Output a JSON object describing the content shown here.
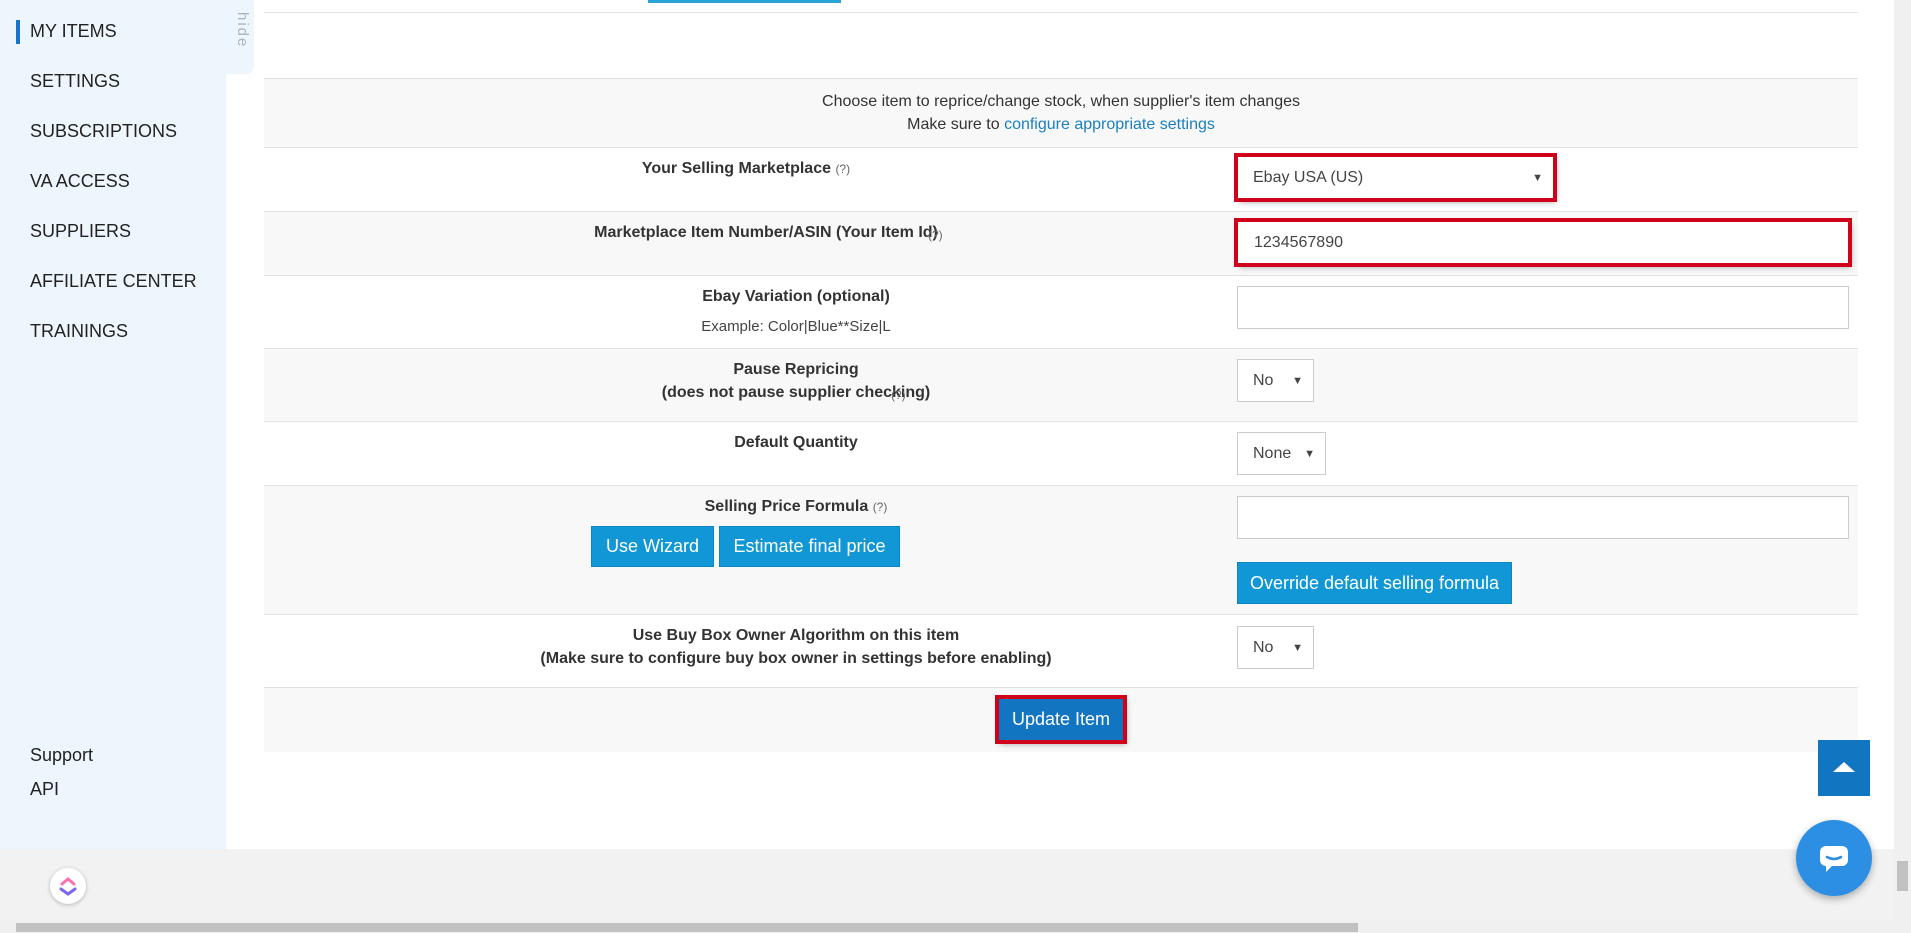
{
  "sidebar": {
    "hide_label": "hide",
    "items": [
      {
        "label": "MY ITEMS",
        "active": true
      },
      {
        "label": "SETTINGS"
      },
      {
        "label": "SUBSCRIPTIONS"
      },
      {
        "label": "VA ACCESS"
      },
      {
        "label": "SUPPLIERS"
      },
      {
        "label": "AFFILIATE CENTER"
      },
      {
        "label": "TRAININGS"
      }
    ],
    "bottom_links": [
      {
        "label": "Support"
      },
      {
        "label": "API"
      }
    ]
  },
  "form": {
    "intro_line1": "Choose item to reprice/change stock, when supplier's item changes",
    "intro_line2_prefix": "Make sure to",
    "intro_link": "configure appropriate settings",
    "help_mark": "(?)",
    "marketplace": {
      "label": "Your Selling Marketplace",
      "value": "Ebay USA (US)"
    },
    "item_number": {
      "label": "Marketplace Item Number/ASIN (Your Item Id)",
      "value": "1234567890"
    },
    "variation": {
      "label": "Ebay Variation (optional)",
      "example": "Example: Color|Blue**Size|L",
      "value": ""
    },
    "pause": {
      "label_line1": "Pause Repricing",
      "label_line2": "(does not pause supplier checking)",
      "value": "No"
    },
    "default_qty": {
      "label": "Default Quantity",
      "value": "None"
    },
    "price_formula": {
      "label": "Selling Price Formula",
      "value": "",
      "wizard_button": "Use Wizard",
      "estimate_button": "Estimate final price",
      "override_button": "Override default selling formula"
    },
    "buy_box": {
      "label_line1": "Use Buy Box Owner Algorithm on this item",
      "label_line2": "(Make sure to configure buy box owner in settings before enabling)",
      "value": "No"
    },
    "submit_button": "Update Item"
  },
  "colors": {
    "accent": "#1197d5",
    "highlight": "#d0021b",
    "sidebar_bg": "#eef6fd"
  },
  "icons": [
    "scroll-top-arrow-icon",
    "chat-icon",
    "clickup-logo-icon",
    "caret-down-icon"
  ]
}
